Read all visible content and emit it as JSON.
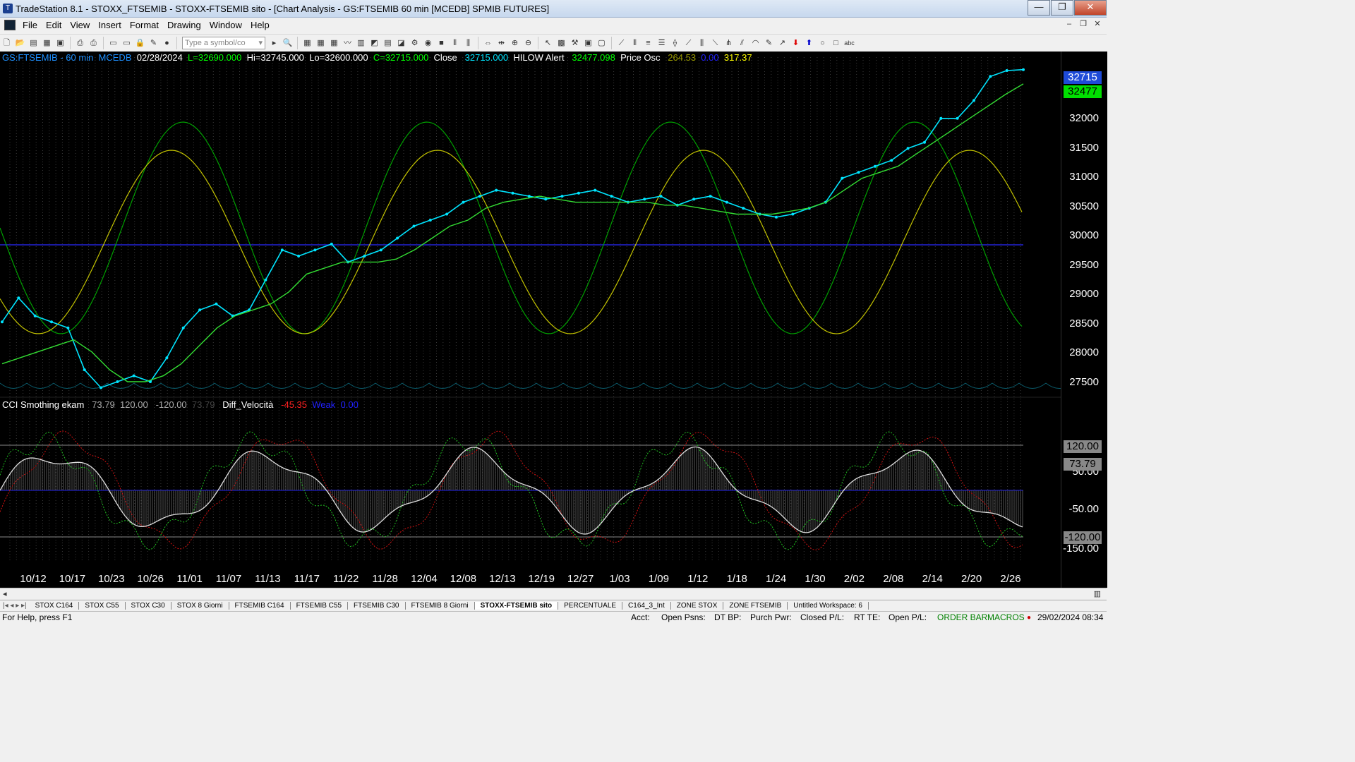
{
  "window": {
    "title": "TradeStation 8.1 - STOXX_FTSEMIB - STOXX-FTSEMIB sito - [Chart Analysis - GS:FTSEMIB  60 min  [MCEDB] SPMIB FUTURES]",
    "minimize": "—",
    "maximize": "❐",
    "close": "✕"
  },
  "menu": [
    "File",
    "Edit",
    "View",
    "Insert",
    "Format",
    "Drawing",
    "Window",
    "Help"
  ],
  "toolbar": {
    "symbol_placeholder": "Type a symbol/co"
  },
  "price_pane": {
    "symbol": "GS:FTSEMIB - 60 min",
    "exchange": "MCEDB",
    "date": "02/28/2024",
    "low_info": "L=32690.000",
    "hi": "Hi=32745.000",
    "lo": "Lo=32600.000",
    "close_info": "C=32715.000",
    "close_label": "Close",
    "close_val": "32715.000",
    "hilow_label": "HILOW Alert",
    "hilow_val": "32477.098",
    "osc_label": "Price Osc",
    "osc_v1": "264.53",
    "osc_v2": "0.00",
    "osc_v3": "317.37",
    "last_price_box": "32715",
    "alert_box": "32477"
  },
  "cci_pane": {
    "label": "CCI Smothing ekam",
    "v1": "73.79",
    "v2": "120.00",
    "v3": "-120.00",
    "v4": "73.79",
    "diff_label": "Diff_Velocità",
    "diff_val": "-45.35",
    "weak_label": "Weak",
    "weak_val": "0.00",
    "box_upper": "120.00",
    "box_value": "73.79",
    "box_lower": "-120.00"
  },
  "y_labels_price": [
    "32000",
    "31500",
    "31000",
    "30500",
    "30000",
    "29500",
    "29000",
    "28500",
    "28000",
    "27500"
  ],
  "y_labels_cci": [
    "50.00",
    "-50.00",
    "-150.00"
  ],
  "x_labels": [
    "10/12",
    "10/17",
    "10/23",
    "10/26",
    "11/01",
    "11/07",
    "11/13",
    "11/17",
    "11/22",
    "11/28",
    "12/04",
    "12/08",
    "12/13",
    "12/19",
    "12/27",
    "1/03",
    "1/09",
    "1/12",
    "1/18",
    "1/24",
    "1/30",
    "2/02",
    "2/08",
    "2/14",
    "2/20",
    "2/26"
  ],
  "tabs": [
    "STOX C164",
    "STOX C55",
    "STOX  C30",
    "STOX  8 Giorni",
    "FTSEMIB C164",
    "FTSEMIB C55",
    "FTSEMIB C30",
    "FTSEMIB  8 Giorni",
    "STOXX-FTSEMIB sito",
    "PERCENTUALE",
    "C164_3_Int",
    "ZONE STOX",
    "ZONE FTSEMIB",
    "Untitled Workspace:  6"
  ],
  "status": {
    "help": "For Help, press F1",
    "acct": "Acct:",
    "open_psns": "Open Psns:",
    "dt_bp": "DT BP:",
    "purch_pwr": "Purch Pwr:",
    "closed_pl": "Closed P/L:",
    "rt_te": "RT TE:",
    "open_pl": "Open P/L:",
    "order_bar": "ORDER BAR",
    "macros": "MACROS",
    "datetime": "29/02/2024 08:34"
  },
  "chart_data": {
    "type": "line",
    "x_range": [
      "10/12",
      "2/26"
    ],
    "price_range": [
      27300,
      32900
    ],
    "series": [
      {
        "name": "Close",
        "values": [
          28500,
          28900,
          28600,
          28500,
          28400,
          27700,
          27400,
          27500,
          27600,
          27500,
          27900,
          28400,
          28700,
          28800,
          28600,
          28700,
          29200,
          29700,
          29600,
          29700,
          29800,
          29500,
          29600,
          29700,
          29900,
          30100,
          30200,
          30300,
          30500,
          30600,
          30700,
          30650,
          30600,
          30550,
          30600,
          30650,
          30700,
          30600,
          30500,
          30550,
          30600,
          30450,
          30550,
          30600,
          30500,
          30400,
          30300,
          30250,
          30300,
          30400,
          30500,
          30900,
          31000,
          31100,
          31200,
          31400,
          31500,
          31900,
          31900,
          32200,
          32600,
          32700,
          32715
        ]
      },
      {
        "name": "HILOW Alert",
        "values": [
          27800,
          27900,
          28000,
          28100,
          28200,
          28000,
          27700,
          27500,
          27500,
          27600,
          27800,
          28100,
          28400,
          28600,
          28700,
          28800,
          29000,
          29300,
          29400,
          29500,
          29500,
          29500,
          29550,
          29700,
          29900,
          30100,
          30200,
          30400,
          30500,
          30550,
          30600,
          30550,
          30500,
          30500,
          30500,
          30500,
          30500,
          30450,
          30450,
          30400,
          30350,
          30300,
          30300,
          30300,
          30350,
          30400,
          30500,
          30700,
          30900,
          31000,
          31100,
          31300,
          31500,
          31700,
          31900,
          32100,
          32300,
          32477
        ]
      }
    ]
  }
}
